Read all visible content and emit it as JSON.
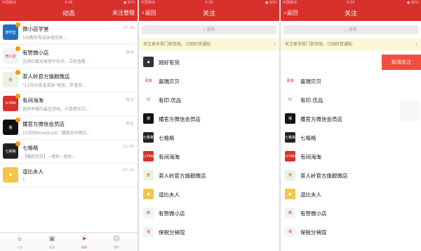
{
  "p1": {
    "status": {
      "carrier": "中国移动",
      "time": "9:36",
      "right": "● 80%"
    },
    "title": "动态",
    "right": "关注管理",
    "items": [
      {
        "name": "微小店学堂",
        "sub": "5招教你零成本做货商…",
        "time": "10-29",
        "av": "微学堂",
        "bg": "#1f6fc0"
      },
      {
        "name": "有赞微小店",
        "sub": "这周红都对来得不抖卡，立即查看…",
        "time": "昨天",
        "av": "微小店",
        "bg": "#f2f2f2"
      },
      {
        "name": "茶人岭官方旗舰微店",
        "sub": "\"11月份奖金奖励\"发放，恭喜获…",
        "time": "",
        "av": "茶",
        "bg": "#e8f3e0"
      },
      {
        "name": "有间海淘",
        "sub": "营养早餐的最佳搭档，卢森堡乐口…",
        "time": "昨天",
        "av": "U-TAN",
        "bg": "#d8302b"
      },
      {
        "name": "播官方微信会员店",
        "sub": "12月份broadcast：播报会分销买…",
        "time": "昨天",
        "av": "播",
        "bg": "#111111"
      },
      {
        "name": "七格格",
        "sub": "【爆款到货】~速抢~速抢~",
        "time": "11-25",
        "av": "七格格",
        "bg": "#222222"
      },
      {
        "name": "逗比夫人",
        "sub": "1",
        "time": "07-20",
        "av": "●",
        "bg": "#f3c64a"
      }
    ],
    "tabs": [
      {
        "icon": "⌂",
        "label": "小店"
      },
      {
        "icon": "▣",
        "label": "货源"
      },
      {
        "icon": "➤",
        "label": "动态"
      },
      {
        "icon": "☺",
        "label": "我的"
      }
    ]
  },
  "p2": {
    "status": {
      "carrier": "中国移动",
      "time": "9:36",
      "right": "● 80%"
    },
    "back": "返回",
    "title": "关注",
    "search": "搜索",
    "notice": "关注更多热门供货商，订阅好货通知",
    "items": [
      {
        "name": "刚好有货",
        "av": "◆",
        "bg": "#333333"
      },
      {
        "name": "嘉瑞贝贝",
        "av": "嘉瑞",
        "bg": "#ffffff"
      },
      {
        "name": "有印.优品",
        "av": "印",
        "bg": "#ffffff"
      },
      {
        "name": "播官方微信会员店",
        "av": "播",
        "bg": "#111111"
      },
      {
        "name": "七格格",
        "av": "七格格",
        "bg": "#222222"
      },
      {
        "name": "有间海淘",
        "av": "U-TAN",
        "bg": "#d8302b"
      },
      {
        "name": "茶人岭官方旗舰微店",
        "av": "茶",
        "bg": "#e8f3e0"
      },
      {
        "name": "逗比夫人",
        "av": "●",
        "bg": "#f3c64a"
      },
      {
        "name": "有赞微小店",
        "av": "微",
        "bg": "#f2f2f2"
      },
      {
        "name": "保税分销馆",
        "av": "保",
        "bg": "#f2f2f2"
      }
    ]
  },
  "p3": {
    "status": {
      "carrier": "中国移动",
      "time": "9:36",
      "right": "● 80%"
    },
    "back": "返回",
    "title": "关注",
    "search": "搜索",
    "notice": "关注更多热门供货商，订阅好货通知",
    "cancel": "取消关注",
    "items": [
      {
        "name": "",
        "av": "",
        "bg": "#ffffff"
      },
      {
        "name": "嘉瑞贝贝",
        "av": "嘉瑞",
        "bg": "#ffffff"
      },
      {
        "name": "有印.优品",
        "av": "印",
        "bg": "#ffffff"
      },
      {
        "name": "播官方微信会员店",
        "av": "播",
        "bg": "#111111"
      },
      {
        "name": "七格格",
        "av": "七格格",
        "bg": "#222222"
      },
      {
        "name": "有间海淘",
        "av": "U-TAN",
        "bg": "#d8302b"
      },
      {
        "name": "茶人岭官方旗舰微店",
        "av": "茶",
        "bg": "#e8f3e0"
      },
      {
        "name": "逗比夫人",
        "av": "●",
        "bg": "#f3c64a"
      },
      {
        "name": "有赞微小店",
        "av": "微",
        "bg": "#f2f2f2"
      },
      {
        "name": "保税分销馆",
        "av": "保",
        "bg": "#f2f2f2"
      }
    ]
  }
}
